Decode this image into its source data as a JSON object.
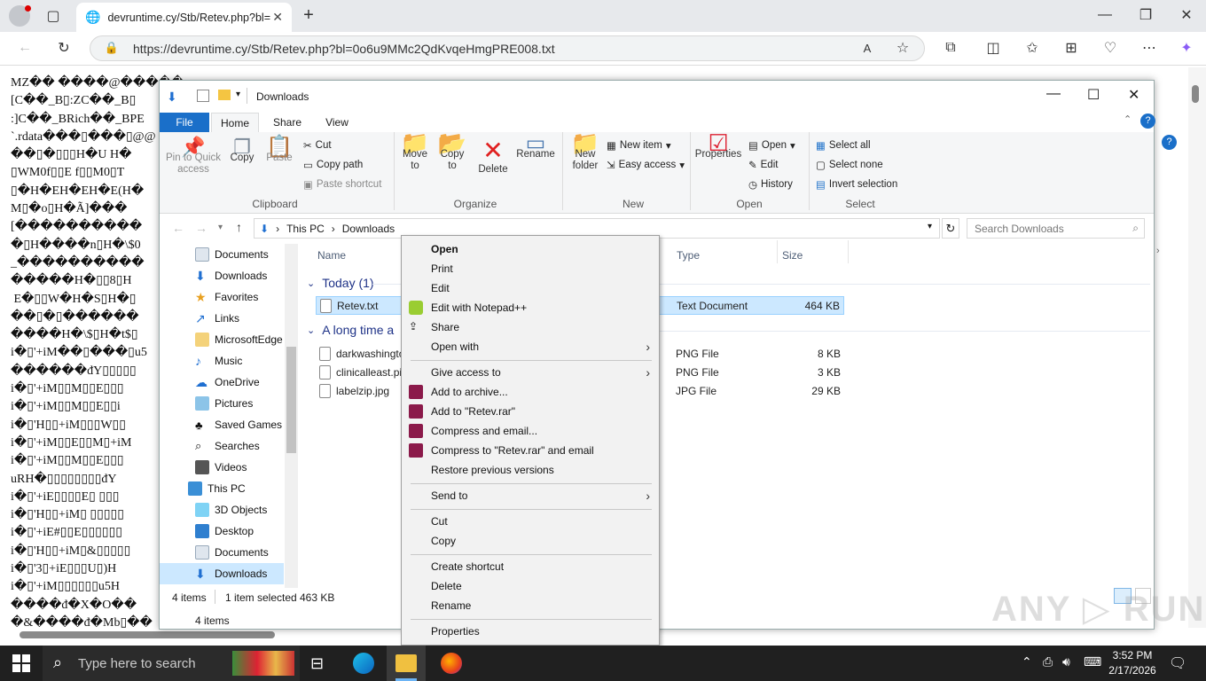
{
  "browser": {
    "tab_title": "devruntime.cy/Stb/Retev.php?bl=",
    "url": "https://devruntime.cy/Stb/Retev.php?bl=0o6u9MMc2QdKvqeHmgPRE008.txt"
  },
  "raw_text": "MZ�� ����@�����\n[C��_B▯:ZC��_B▯\n:]C��_BRich��_BPE\n`.rdata���▯���▯@@\n��▯�▯▯▯H�U H�\n▯WM0f▯▯E f▯▯M0▯T\n▯�H�EH�EH�E(H�\nM▯�o▯H�Ã]���\n[����������\n�▯H����n▯H�\\$0\n_����������\n�����H�▯▯8▯H\n E�▯▯W�H�S▯H�▯\n��▯�▯������\n����H�\\$▯H�t$▯\ni�▯'+iM��▯���▯u5\n������đY▯▯▯▯▯\ni�▯'+iM▯▯M▯▯E▯▯▯\ni�▯'+iM▯▯M▯▯E▯▯i\ni�▯'H▯▯+iM▯▯▯W▯▯\ni�▯'+iM▯▯E▯▯M▯+iM\ni�▯'+iM▯▯M▯▯E▯▯▯\nuRH�▯▯▯▯▯▯▯▯đY\ni�▯'+iE▯▯▯▯E▯ ▯▯▯\ni�▯'H▯▯+iM▯ ▯▯▯▯▯\ni�▯'+iE#▯▯E▯▯▯▯▯▯\ni�▯'H▯▯+iM▯&▯▯▯▯▯\ni�▯'3▯+iE▯▯▯U▯)H\ni�▯'+iM▯▯▯▯▯▯u5H\n����đ�X�O��\n�&����đ�Mb▯��\ni▯'H▯▯+iM▯3▯▯▯▯▯đ",
  "explorer": {
    "title": "Downloads",
    "ribbon_tabs": [
      "File",
      "Home",
      "Share",
      "View"
    ],
    "clipboard": {
      "pin": "Pin to Quick access",
      "copy": "Copy",
      "paste": "Paste",
      "cut": "Cut",
      "copy_path": "Copy path",
      "paste_shortcut": "Paste shortcut",
      "label": "Clipboard"
    },
    "organize": {
      "move": "Move to",
      "copy_to": "Copy to",
      "delete": "Delete",
      "rename": "Rename",
      "label": "Organize"
    },
    "new": {
      "folder": "New folder",
      "item": "New item",
      "easy": "Easy access",
      "label": "New"
    },
    "open": {
      "properties": "Properties",
      "open": "Open",
      "edit": "Edit",
      "history": "History",
      "label": "Open"
    },
    "select": {
      "all": "Select all",
      "none": "Select none",
      "invert": "Invert selection",
      "label": "Select"
    },
    "breadcrumb": [
      "This PC",
      "Downloads"
    ],
    "search_placeholder": "Search Downloads",
    "nav": [
      "Documents",
      "Downloads",
      "Favorites",
      "Links",
      "MicrosoftEdge",
      "Music",
      "OneDrive",
      "Pictures",
      "Saved Games",
      "Searches",
      "Videos",
      "This PC",
      "3D Objects",
      "Desktop",
      "Documents",
      "Downloads"
    ],
    "columns": {
      "name": "Name",
      "type": "Type",
      "size": "Size"
    },
    "groups": {
      "today": "Today (1)",
      "long": "A long time a"
    },
    "files": [
      {
        "name": "Retev.txt",
        "type": "Text Document",
        "size": "464 KB"
      },
      {
        "name": "darkwashingto",
        "type": "PNG File",
        "size": "8 KB"
      },
      {
        "name": "clinicalleast.pi",
        "type": "PNG File",
        "size": "3 KB"
      },
      {
        "name": "labelzip.jpg",
        "type": "JPG File",
        "size": "29 KB"
      }
    ],
    "status": {
      "items": "4 items",
      "selected": "1 item selected",
      "sel_size": "463 KB",
      "bottom": "4 items"
    }
  },
  "context_menu": [
    "Open",
    "Print",
    "Edit",
    "Edit with Notepad++",
    "Share",
    "Open with",
    "Give access to",
    "Add to archive...",
    "Add to \"Retev.rar\"",
    "Compress and email...",
    "Compress to \"Retev.rar\" and email",
    "Restore previous versions",
    "Send to",
    "Cut",
    "Copy",
    "Create shortcut",
    "Delete",
    "Rename",
    "Properties"
  ],
  "taskbar": {
    "search": "Type here to search",
    "time": "3:52 PM",
    "date": "2/17/2026"
  },
  "colors": {
    "accent": "#0078d4",
    "taskbar": "#202020",
    "selection": "#cce8ff"
  }
}
